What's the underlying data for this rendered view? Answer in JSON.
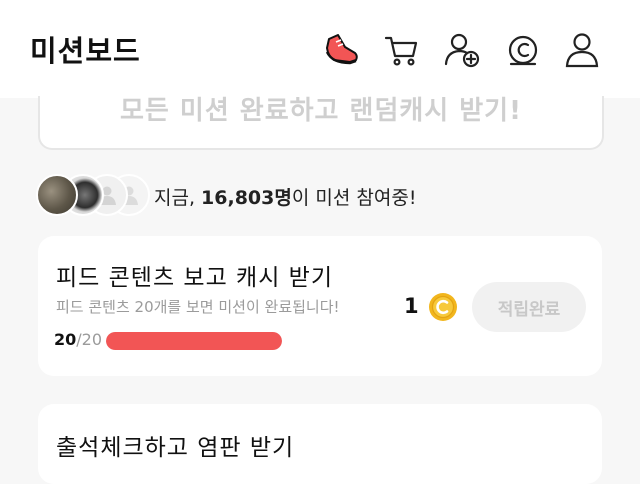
{
  "header": {
    "title": "미션보드",
    "icons": [
      "sneaker-icon",
      "cart-icon",
      "add-friend-icon",
      "cash-coin-icon",
      "profile-icon"
    ]
  },
  "banner": {
    "text": "모든 미션 완료하고 랜덤캐시 받기!"
  },
  "participants": {
    "prefix": "지금, ",
    "count": "16,803명",
    "suffix": "이 미션 참여중!"
  },
  "missions": [
    {
      "title": "피드 콘텐츠 보고 캐시 받기",
      "subtitle": "피드 콘텐츠 20개를 보면 미션이 완료됩니다!",
      "progress_current": "20",
      "progress_total": "/20",
      "progress_fraction": 1.0,
      "reward": "1",
      "button_label": "적립완료"
    },
    {
      "title": "출석체크하고 염판 받기"
    }
  ],
  "colors": {
    "accent_red": "#f25555",
    "coin_gold": "#f2b61d",
    "banner_text": "#cfcfcf"
  }
}
